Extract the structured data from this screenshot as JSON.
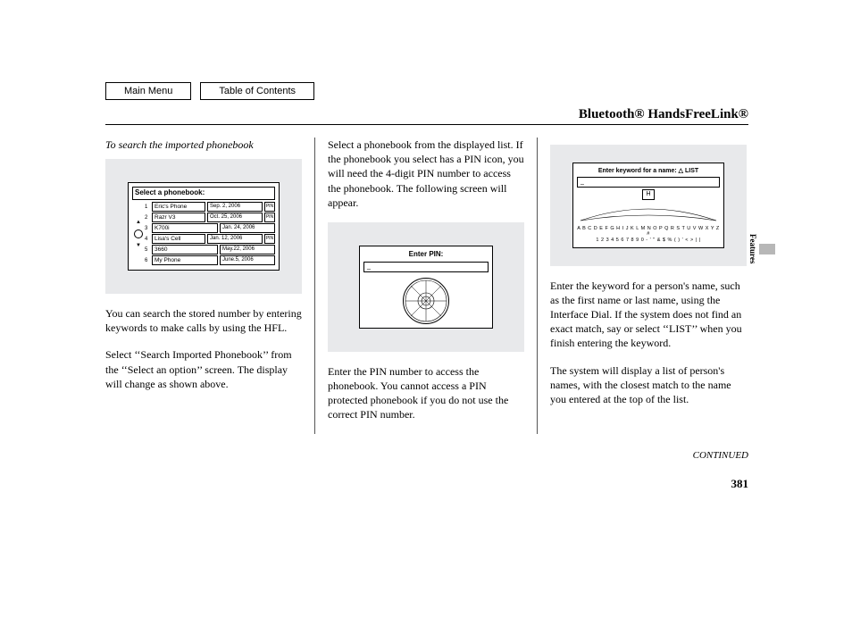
{
  "nav": {
    "main_menu": "Main Menu",
    "toc": "Table of Contents"
  },
  "title": "Bluetooth® HandsFreeLink®",
  "side_tab": "Features",
  "continued": "CONTINUED",
  "page_number": "381",
  "col1": {
    "subhead": "To search the imported phonebook",
    "screen": {
      "heading": "Select a phonebook:",
      "rows": [
        {
          "n": "1",
          "name": "Eric's Phone",
          "date": "Sep. 2, 2006",
          "pin": true
        },
        {
          "n": "2",
          "name": "Razr V3",
          "date": "Oct. 25, 2006",
          "pin": true
        },
        {
          "n": "3",
          "name": "K700i",
          "date": "Jan. 24, 2006",
          "pin": false
        },
        {
          "n": "4",
          "name": "Lisa's Cell",
          "date": "Jan. 12, 2006",
          "pin": true
        },
        {
          "n": "5",
          "name": "3660",
          "date": "May.22, 2006",
          "pin": false
        },
        {
          "n": "6",
          "name": "My Phone",
          "date": "June.5, 2006",
          "pin": false
        }
      ]
    },
    "p1": "You can search the stored number by entering keywords to make calls by using the HFL.",
    "p2": "Select ‘‘Search Imported Phonebook’’ from the ‘‘Select an option’’ screen. The display will change as shown above."
  },
  "col2": {
    "p1": "Select a phonebook from the displayed list. If the phonebook you select has a PIN icon, you will need the 4-digit PIN number to access the phonebook. The following screen will appear.",
    "screen": {
      "label": "Enter PIN:",
      "field": "_"
    },
    "p2": "Enter the PIN number to access the phonebook. You cannot access a PIN protected phonebook if you do not use the correct PIN number."
  },
  "col3": {
    "screen": {
      "label": "Enter keyword for a name: △ LIST",
      "field": "_",
      "letter": "H",
      "arc1": "A B C D E F G H I J K L M N O P Q R S T U V W X Y Z #",
      "arc2": "1 2 3 4 5 6 7 8 9 0  - '  \" & $ %  ( )  ' < > | |"
    },
    "p1": "Enter the keyword for a person's name, such as the first name or last name, using the Interface Dial. If the system does not find an exact match, say or select ‘‘LIST’’ when you finish entering the keyword.",
    "p2": "The system will display a list of person's names, with the closest match to the name you entered at the top of the list."
  }
}
